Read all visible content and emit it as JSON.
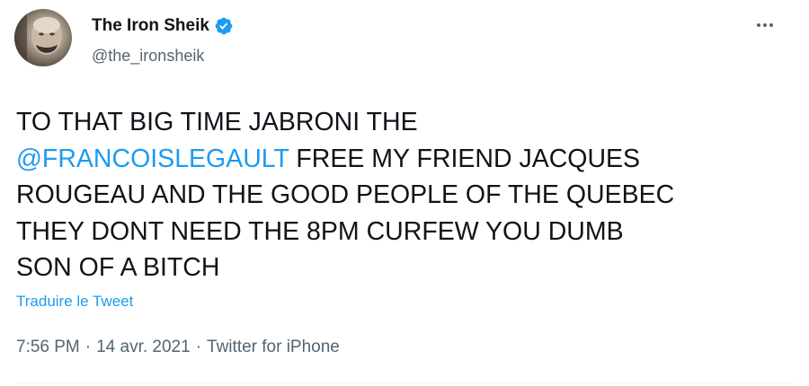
{
  "author": {
    "display_name": "The Iron Sheik",
    "handle": "@the_ironsheik",
    "verified": true,
    "avatar": "profile-photo"
  },
  "tweet": {
    "line1": "TO THAT BIG TIME JABRONI THE",
    "mention": "@FRANCOISLEGAULT",
    "line2_rest": " FREE MY FRIEND JACQUES",
    "line3": "ROUGEAU AND THE GOOD PEOPLE OF THE QUEBEC",
    "line4": "THEY DONT NEED THE 8PM CURFEW YOU DUMB",
    "line5": "SON OF A BITCH"
  },
  "translate_label": "Traduire le Tweet",
  "meta": {
    "time": "7:56 PM",
    "separator": "·",
    "date": "14 avr. 2021",
    "source": "Twitter for iPhone"
  },
  "icons": {
    "verified": "verified-badge-icon",
    "more": "more-options-icon"
  },
  "colors": {
    "accent": "#1d9bf0",
    "text": "#0f1419",
    "secondary": "#536471"
  }
}
